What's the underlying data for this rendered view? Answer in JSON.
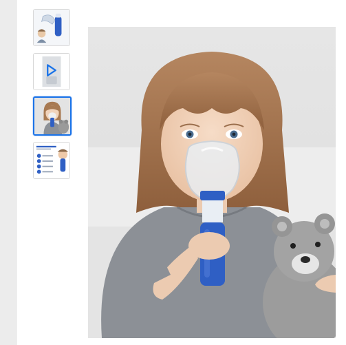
{
  "gallery": {
    "selected_index": 2,
    "thumbnails": [
      {
        "name": "thumbnail-product-kit"
      },
      {
        "name": "thumbnail-video-play"
      },
      {
        "name": "thumbnail-child-using-nebulizer"
      },
      {
        "name": "thumbnail-infographic"
      }
    ]
  },
  "main_image": {
    "subject": "child-with-nebulizer-mask-and-teddy-bear"
  },
  "colors": {
    "accent": "#1a73e8",
    "device_blue": "#2f5fc4",
    "shirt_gray": "#8a8f95",
    "rail": "#ececec"
  }
}
